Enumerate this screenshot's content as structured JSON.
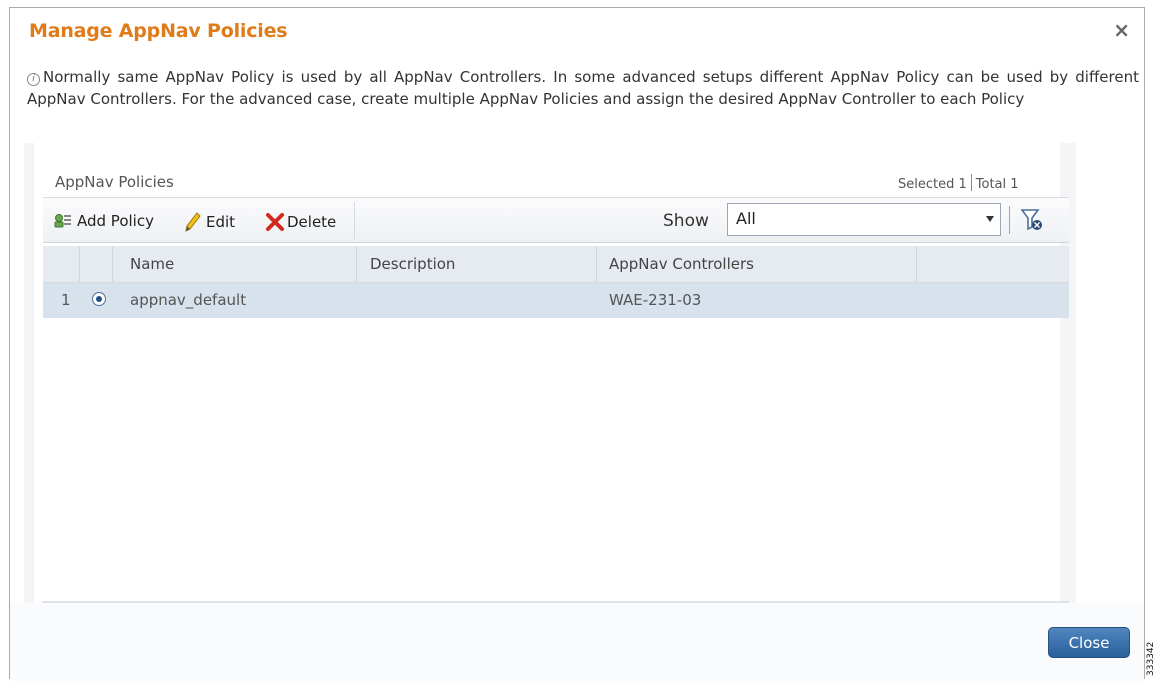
{
  "dialog": {
    "title": "Manage AppNav Policies",
    "close_symbol": "×",
    "info_icon": "i",
    "info_text": "Normally same AppNav Policy is used by all AppNav Controllers. In some advanced setups different AppNav Policy can be used by different AppNav Controllers. For the advanced case, create multiple AppNav Policies and assign the desired AppNav Controller to each Policy"
  },
  "panel": {
    "title": "AppNav Policies",
    "selected_label": "Selected 1",
    "total_label": "Total 1"
  },
  "toolbar": {
    "add_label": "Add Policy",
    "edit_label": "Edit",
    "delete_label": "Delete",
    "show_label": "Show",
    "show_value": "All"
  },
  "table": {
    "columns": [
      "Name",
      "Description",
      "AppNav Controllers"
    ],
    "rows": [
      {
        "index": "1",
        "name": "appnav_default",
        "description": "",
        "controllers": "WAE-231-03",
        "selected": true
      }
    ]
  },
  "footer": {
    "close_label": "Close",
    "figure_id": "333342"
  },
  "colors": {
    "title": "#e07b1a",
    "selected_row": "#d8e2ed",
    "header_row": "#e6ebf1",
    "button": "#3a6fa9"
  },
  "icons": [
    "close-icon",
    "info-icon",
    "add-policy-icon",
    "edit-pencil-icon",
    "delete-x-icon",
    "chevron-down-icon",
    "filter-icon",
    "radio-selected-icon"
  ]
}
